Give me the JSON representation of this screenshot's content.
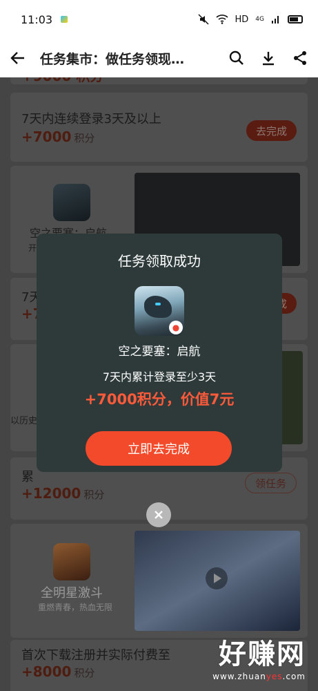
{
  "status_bar": {
    "time": "11:03",
    "network": "HD",
    "signal": "4G"
  },
  "header": {
    "title": "任务集市：做任务领现…"
  },
  "background": {
    "partial_points": "+9000 积分",
    "task1": {
      "text": "7天内连续登录3天及以上",
      "points": "+7000",
      "unit": "积分",
      "button": "去完成"
    },
    "video1": {
      "game_name": "空之要塞：启航",
      "sub": "开"
    },
    "task2": {
      "text": "7天",
      "points": "+7",
      "button": "成"
    },
    "video2": {
      "sub": "以历史"
    },
    "task3": {
      "text": "累",
      "points": "+12000",
      "unit": "积分",
      "button": "领任务"
    },
    "video3": {
      "game_name": "全明星激斗",
      "slogan": "重燃青春，热血无限"
    },
    "task4": {
      "text": "首次下载注册并实际付费至",
      "points": "+8000",
      "unit": "积分"
    }
  },
  "modal": {
    "title": "任务领取成功",
    "game_name": "空之要塞：启航",
    "description": "7天内累计登录至少3天",
    "reward": "+7000积分，价值7元",
    "button_label": "立即去完成"
  },
  "watermark": {
    "main": "好赚网",
    "url_prefix": "www.zhuan",
    "url_accent": "yes",
    "url_suffix": ".com"
  },
  "colors": {
    "accent": "#f24a2a",
    "reward": "#ff5a3a",
    "modal_bg": "#2e3a3a"
  }
}
